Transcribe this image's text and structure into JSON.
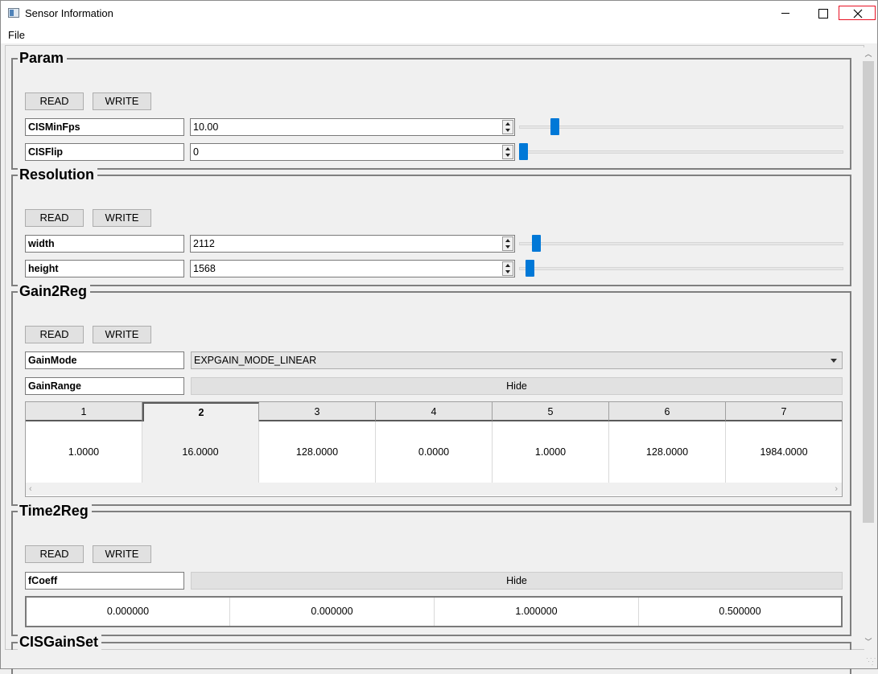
{
  "window": {
    "title": "Sensor Information",
    "menu": {
      "file": "File"
    }
  },
  "groups": {
    "param": {
      "title": "Param",
      "read": "READ",
      "write": "WRITE",
      "rows": [
        {
          "name": "CISMinFps",
          "value": "10.00",
          "slider_level": 0.1
        },
        {
          "name": "CISFlip",
          "value": "0",
          "slider_level": 0.0
        }
      ]
    },
    "resolution": {
      "title": "Resolution",
      "read": "READ",
      "write": "WRITE",
      "rows": [
        {
          "name": "width",
          "value": "2112",
          "slider_level": 0.04
        },
        {
          "name": "height",
          "value": "1568",
          "slider_level": 0.02
        }
      ]
    },
    "gain2reg": {
      "title": "Gain2Reg",
      "read": "READ",
      "write": "WRITE",
      "gain_mode_label": "GainMode",
      "gain_mode_value": "EXPGAIN_MODE_LINEAR",
      "gain_range_label": "GainRange",
      "gain_range_button": "Hide",
      "table_headers": [
        "1",
        "2",
        "3",
        "4",
        "5",
        "6",
        "7"
      ],
      "table_values": [
        "1.0000",
        "16.0000",
        "128.0000",
        "0.0000",
        "1.0000",
        "128.0000",
        "1984.0000"
      ],
      "active_column": 2
    },
    "time2reg": {
      "title": "Time2Reg",
      "read": "READ",
      "write": "WRITE",
      "coeff_label": "fCoeff",
      "coeff_button": "Hide",
      "coeff_values": [
        "0.000000",
        "0.000000",
        "1.000000",
        "0.500000"
      ]
    },
    "cisgainset": {
      "title": "CISGainSet"
    }
  }
}
